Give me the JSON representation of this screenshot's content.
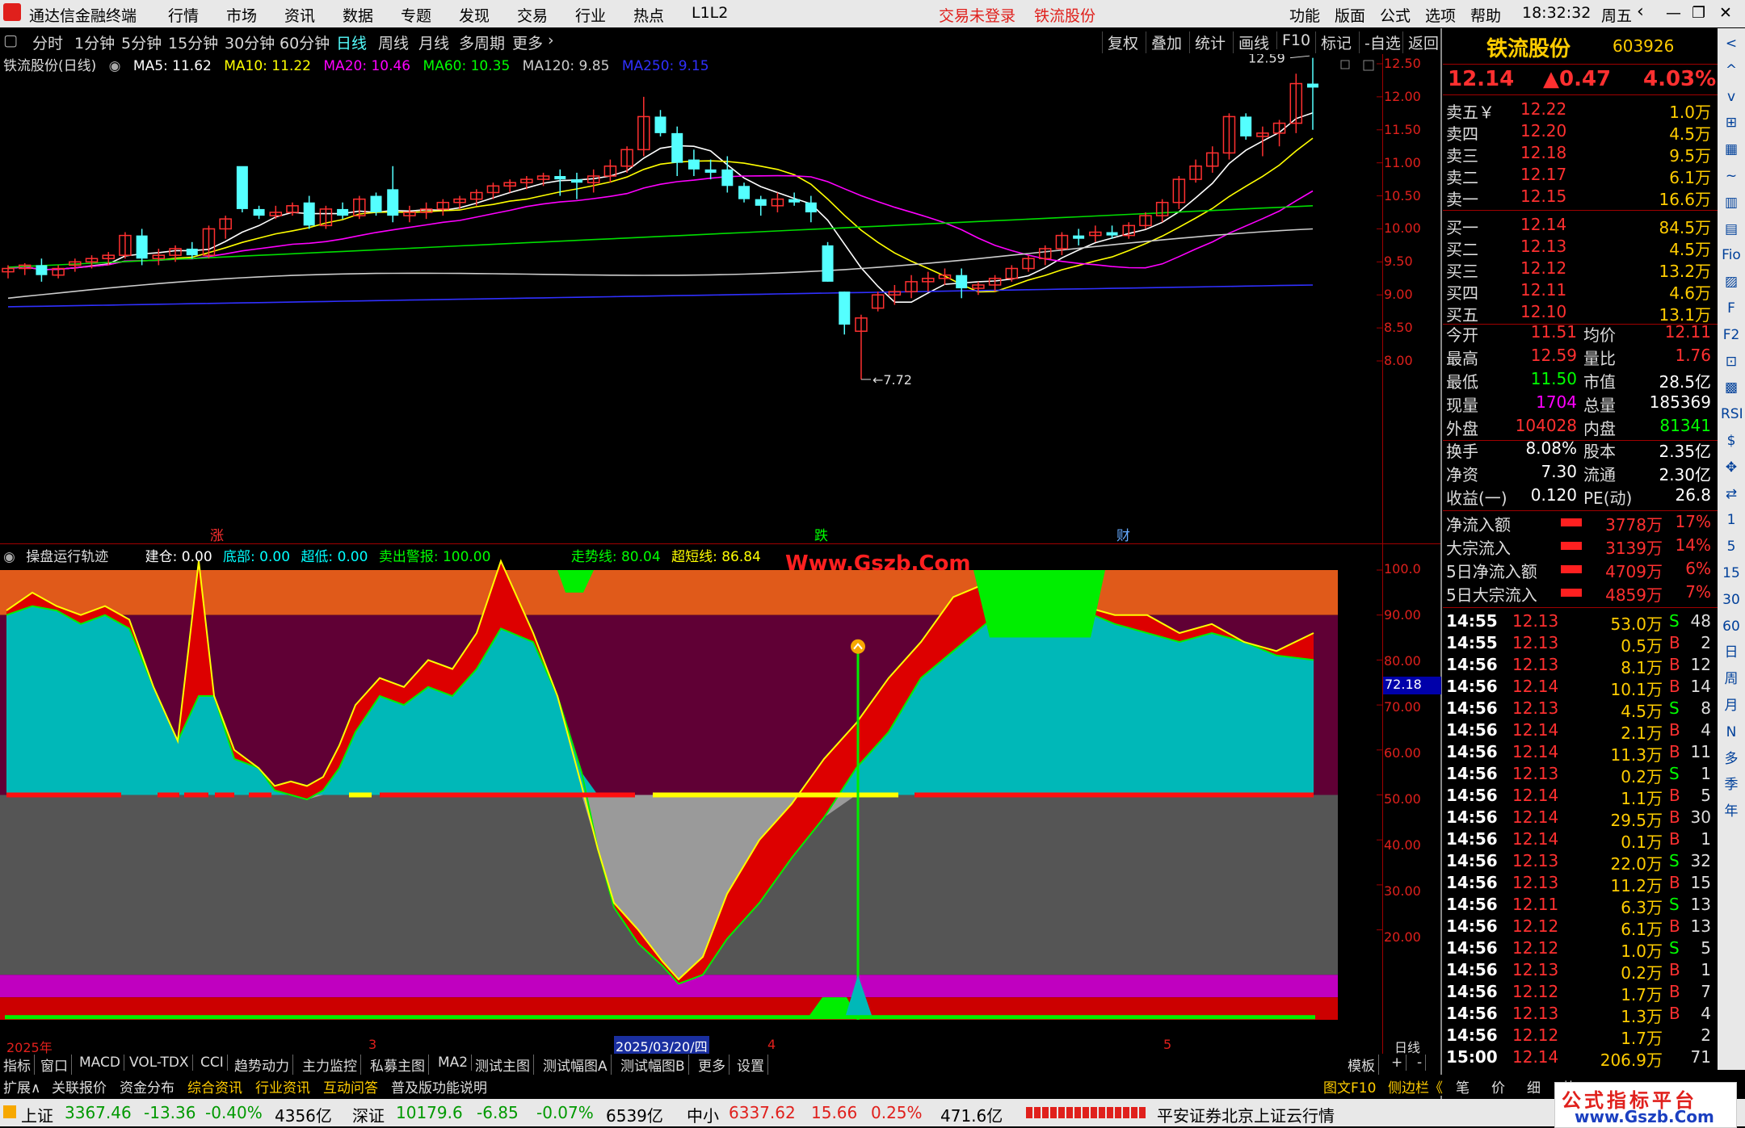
{
  "app": {
    "logo_text": "通达信金融终端",
    "menu": [
      "行情",
      "市场",
      "资讯",
      "数据",
      "专题",
      "发现",
      "交易",
      "行业",
      "热点",
      "L1L2"
    ],
    "trade_status": "交易未登录",
    "stock_short": "铁流股份",
    "right_menu": [
      "功能",
      "版面",
      "公式",
      "选项",
      "帮助"
    ],
    "time": "18:32:32",
    "weekday": "周五"
  },
  "timeframe": {
    "tabs": [
      "分时",
      "1分钟",
      "5分钟",
      "15分钟",
      "30分钟",
      "60分钟",
      "日线",
      "周线",
      "月线",
      "多周期",
      "更多"
    ],
    "active": "日线",
    "tools": [
      "复权",
      "叠加",
      "统计",
      "画线",
      "F10",
      "标记",
      "-自选",
      "返回"
    ]
  },
  "ma_header": {
    "title": "铁流股份(日线)",
    "items": [
      {
        "label": "MA5: 11.62",
        "color": "#ffffff"
      },
      {
        "label": "MA10: 11.22",
        "color": "#ffff00"
      },
      {
        "label": "MA20: 10.46",
        "color": "#ff00ff"
      },
      {
        "label": "MA60: 10.35",
        "color": "#00ff00"
      },
      {
        "label": "MA120: 9.85",
        "color": "#cccccc"
      },
      {
        "label": "MA250: 9.15",
        "color": "#3030ff"
      }
    ]
  },
  "price_axis": [
    "12.50",
    "12.00",
    "11.50",
    "11.00",
    "10.50",
    "10.00",
    "9.50",
    "9.00",
    "8.50",
    "8.00"
  ],
  "price_annotations": {
    "high": "12.59",
    "low": "7.72"
  },
  "markers": [
    {
      "text": "涨",
      "color": "#ff3030"
    },
    {
      "text": "跌",
      "color": "#00ff00"
    },
    {
      "text": "财",
      "color": "#66aaff"
    }
  ],
  "indicator_header": {
    "title": "操盘运行轨迹",
    "items": [
      {
        "label": "建仓: 0.00",
        "color": "#ffffff"
      },
      {
        "label": "底部: 0.00",
        "color": "#00ffff"
      },
      {
        "label": "超低: 0.00",
        "color": "#00ffff"
      },
      {
        "label": "卖出警报: 100.00",
        "color": "#00ff00"
      },
      {
        "label": "走势线: 80.04",
        "color": "#00ff00"
      },
      {
        "label": "超短线: 86.84",
        "color": "#ffff00"
      }
    ],
    "watermark": "Www.Gszb.Com"
  },
  "indicator_axis": [
    "100.0",
    "90.00",
    "80.00",
    "70.00",
    "60.00",
    "50.00",
    "40.00",
    "30.00",
    "20.00"
  ],
  "indicator_current": "72.18",
  "date_axis": {
    "labels": [
      "2025年",
      "3",
      "2025/03/20/四",
      "4",
      "5"
    ],
    "period": "日线"
  },
  "chart_data": {
    "type": "candlestick",
    "y_range": [
      7.72,
      12.59
    ],
    "candles": [
      [
        9.35,
        9.45,
        9.25,
        9.4
      ],
      [
        9.4,
        9.48,
        9.3,
        9.45
      ],
      [
        9.45,
        9.55,
        9.2,
        9.3
      ],
      [
        9.3,
        9.45,
        9.25,
        9.4
      ],
      [
        9.45,
        9.55,
        9.35,
        9.5
      ],
      [
        9.5,
        9.6,
        9.4,
        9.55
      ],
      [
        9.55,
        9.65,
        9.45,
        9.6
      ],
      [
        9.6,
        9.95,
        9.55,
        9.9
      ],
      [
        9.9,
        10.0,
        9.45,
        9.55
      ],
      [
        9.55,
        9.7,
        9.45,
        9.6
      ],
      [
        9.6,
        9.75,
        9.5,
        9.7
      ],
      [
        9.7,
        9.8,
        9.55,
        9.6
      ],
      [
        9.6,
        10.05,
        9.55,
        10.0
      ],
      [
        10.0,
        10.2,
        9.85,
        10.15
      ],
      [
        10.95,
        10.5,
        10.25,
        10.3
      ],
      [
        10.3,
        10.35,
        10.15,
        10.2
      ],
      [
        10.2,
        10.35,
        10.15,
        10.25
      ],
      [
        10.25,
        10.4,
        10.2,
        10.35
      ],
      [
        10.4,
        10.5,
        10.0,
        10.05
      ],
      [
        10.05,
        10.35,
        10.0,
        10.3
      ],
      [
        10.3,
        10.4,
        10.15,
        10.2
      ],
      [
        10.2,
        10.5,
        10.15,
        10.45
      ],
      [
        10.5,
        10.55,
        10.2,
        10.25
      ],
      [
        10.6,
        10.95,
        10.1,
        10.2
      ],
      [
        10.2,
        10.35,
        10.1,
        10.25
      ],
      [
        10.25,
        10.4,
        10.15,
        10.3
      ],
      [
        10.3,
        10.45,
        10.2,
        10.4
      ],
      [
        10.4,
        10.5,
        10.3,
        10.45
      ],
      [
        10.45,
        10.6,
        10.35,
        10.55
      ],
      [
        10.55,
        10.7,
        10.45,
        10.65
      ],
      [
        10.65,
        10.75,
        10.55,
        10.7
      ],
      [
        10.7,
        10.8,
        10.6,
        10.75
      ],
      [
        10.75,
        10.85,
        10.65,
        10.8
      ],
      [
        10.8,
        10.9,
        10.5,
        10.75
      ],
      [
        10.75,
        10.85,
        10.45,
        10.7
      ],
      [
        10.7,
        10.9,
        10.55,
        10.8
      ],
      [
        10.8,
        11.05,
        10.7,
        10.95
      ],
      [
        10.95,
        11.25,
        10.85,
        11.2
      ],
      [
        11.2,
        12.0,
        11.1,
        11.7
      ],
      [
        11.7,
        11.8,
        11.4,
        11.45
      ],
      [
        11.45,
        11.55,
        10.8,
        11.0
      ],
      [
        11.05,
        11.2,
        10.8,
        10.9
      ],
      [
        10.9,
        11.05,
        10.75,
        10.85
      ],
      [
        10.9,
        11.1,
        10.55,
        10.65
      ],
      [
        10.65,
        10.7,
        10.4,
        10.45
      ],
      [
        10.45,
        10.5,
        10.2,
        10.35
      ],
      [
        10.35,
        10.55,
        10.25,
        10.45
      ],
      [
        10.45,
        10.55,
        10.35,
        10.4
      ],
      [
        10.4,
        10.5,
        10.1,
        10.25
      ],
      [
        9.75,
        9.8,
        9.2,
        9.2
      ],
      [
        9.05,
        9.05,
        8.4,
        8.55
      ],
      [
        8.45,
        8.7,
        7.72,
        8.65
      ],
      [
        8.8,
        9.05,
        8.75,
        9.0
      ],
      [
        9.0,
        9.15,
        8.85,
        9.05
      ],
      [
        9.05,
        9.3,
        8.95,
        9.2
      ],
      [
        9.2,
        9.35,
        9.05,
        9.25
      ],
      [
        9.25,
        9.4,
        9.15,
        9.3
      ],
      [
        9.3,
        9.4,
        8.95,
        9.1
      ],
      [
        9.1,
        9.2,
        9.0,
        9.15
      ],
      [
        9.15,
        9.3,
        9.05,
        9.25
      ],
      [
        9.25,
        9.45,
        9.2,
        9.4
      ],
      [
        9.4,
        9.6,
        9.35,
        9.55
      ],
      [
        9.55,
        9.75,
        9.45,
        9.7
      ],
      [
        9.7,
        9.95,
        9.6,
        9.9
      ],
      [
        9.9,
        10.0,
        9.75,
        9.85
      ],
      [
        9.9,
        10.05,
        9.8,
        9.95
      ],
      [
        9.95,
        10.05,
        9.85,
        9.9
      ],
      [
        9.9,
        10.1,
        9.85,
        10.05
      ],
      [
        10.05,
        10.25,
        10.0,
        10.2
      ],
      [
        10.2,
        10.45,
        10.1,
        10.4
      ],
      [
        10.4,
        10.8,
        10.3,
        10.75
      ],
      [
        10.75,
        11.05,
        10.7,
        10.95
      ],
      [
        10.95,
        11.25,
        10.85,
        11.15
      ],
      [
        11.15,
        11.75,
        11.05,
        11.7
      ],
      [
        11.7,
        11.75,
        11.35,
        11.4
      ],
      [
        11.4,
        11.55,
        11.1,
        11.45
      ],
      [
        11.45,
        11.65,
        11.25,
        11.6
      ],
      [
        11.6,
        12.35,
        11.45,
        12.2
      ],
      [
        12.2,
        12.59,
        11.5,
        12.14
      ]
    ]
  },
  "quote": {
    "name": "铁流股份",
    "code": "603926",
    "price": "12.14",
    "change": "▲0.47",
    "pct": "4.03%",
    "asks": [
      {
        "label": "卖五￥",
        "price": "12.22",
        "vol": "1.0万"
      },
      {
        "label": "卖四",
        "price": "12.20",
        "vol": "4.5万"
      },
      {
        "label": "卖三",
        "price": "12.18",
        "vol": "9.5万"
      },
      {
        "label": "卖二",
        "price": "12.17",
        "vol": "6.1万"
      },
      {
        "label": "卖一",
        "price": "12.15",
        "vol": "16.6万"
      }
    ],
    "bids": [
      {
        "label": "买一",
        "price": "12.14",
        "vol": "84.5万"
      },
      {
        "label": "买二",
        "price": "12.13",
        "vol": "4.5万"
      },
      {
        "label": "买三",
        "price": "12.12",
        "vol": "13.2万"
      },
      {
        "label": "买四",
        "price": "12.11",
        "vol": "4.6万"
      },
      {
        "label": "买五",
        "price": "12.10",
        "vol": "13.1万"
      }
    ],
    "stats1": [
      {
        "l": "今开",
        "v": "11.51",
        "vc": "#ff3030",
        "l2": "均价",
        "v2": "12.11",
        "v2c": "#ff3030"
      },
      {
        "l": "最高",
        "v": "12.59",
        "vc": "#ff3030",
        "l2": "量比",
        "v2": "1.76",
        "v2c": "#ff3030"
      },
      {
        "l": "最低",
        "v": "11.50",
        "vc": "#00ff00",
        "l2": "市值",
        "v2": "28.5亿",
        "v2c": "#ffffff"
      },
      {
        "l": "现量",
        "v": "1704",
        "vc": "#ff00ff",
        "l2": "总量",
        "v2": "185369",
        "v2c": "#ffffff"
      },
      {
        "l": "外盘",
        "v": "104028",
        "vc": "#ff3030",
        "l2": "内盘",
        "v2": "81341",
        "v2c": "#00ff00"
      }
    ],
    "stats2": [
      {
        "l": "换手",
        "v": "8.08%",
        "l2": "股本",
        "v2": "2.35亿"
      },
      {
        "l": "净资",
        "v": "7.30",
        "l2": "流通",
        "v2": "2.30亿"
      },
      {
        "l": "收益(一)",
        "v": "0.120",
        "l2": "PE(动)",
        "v2": "26.8"
      }
    ],
    "flows": [
      {
        "l": "净流入额",
        "v": "3778万",
        "p": "17%"
      },
      {
        "l": "大宗流入",
        "v": "3139万",
        "p": "14%"
      },
      {
        "l": "5日净流入额",
        "v": "4709万",
        "p": "6%"
      },
      {
        "l": "5日大宗流入",
        "v": "4859万",
        "p": "7%"
      }
    ],
    "ticks": [
      {
        "t": "14:55",
        "p": "12.13",
        "v": "53.0万",
        "d": "S",
        "n": "48"
      },
      {
        "t": "14:55",
        "p": "12.13",
        "v": "0.5万",
        "d": "B",
        "n": "2"
      },
      {
        "t": "14:56",
        "p": "12.13",
        "v": "8.1万",
        "d": "B",
        "n": "12"
      },
      {
        "t": "14:56",
        "p": "12.14",
        "v": "10.1万",
        "d": "B",
        "n": "14"
      },
      {
        "t": "14:56",
        "p": "12.13",
        "v": "4.5万",
        "d": "S",
        "n": "8"
      },
      {
        "t": "14:56",
        "p": "12.14",
        "v": "2.1万",
        "d": "B",
        "n": "4"
      },
      {
        "t": "14:56",
        "p": "12.14",
        "v": "11.3万",
        "d": "B",
        "n": "11"
      },
      {
        "t": "14:56",
        "p": "12.13",
        "v": "0.2万",
        "d": "S",
        "n": "1"
      },
      {
        "t": "14:56",
        "p": "12.14",
        "v": "1.1万",
        "d": "B",
        "n": "5"
      },
      {
        "t": "14:56",
        "p": "12.14",
        "v": "29.5万",
        "d": "B",
        "n": "30"
      },
      {
        "t": "14:56",
        "p": "12.14",
        "v": "0.1万",
        "d": "B",
        "n": "1"
      },
      {
        "t": "14:56",
        "p": "12.13",
        "v": "22.0万",
        "d": "S",
        "n": "32"
      },
      {
        "t": "14:56",
        "p": "12.13",
        "v": "11.2万",
        "d": "B",
        "n": "15"
      },
      {
        "t": "14:56",
        "p": "12.11",
        "v": "6.3万",
        "d": "S",
        "n": "13"
      },
      {
        "t": "14:56",
        "p": "12.12",
        "v": "6.1万",
        "d": "B",
        "n": "13"
      },
      {
        "t": "14:56",
        "p": "12.12",
        "v": "1.0万",
        "d": "S",
        "n": "5"
      },
      {
        "t": "14:56",
        "p": "12.13",
        "v": "0.2万",
        "d": "B",
        "n": "1"
      },
      {
        "t": "14:56",
        "p": "12.12",
        "v": "1.7万",
        "d": "B",
        "n": "7"
      },
      {
        "t": "14:56",
        "p": "12.13",
        "v": "1.3万",
        "d": "B",
        "n": "4"
      },
      {
        "t": "14:56",
        "p": "12.12",
        "v": "1.7万",
        "d": "",
        "n": "2"
      },
      {
        "t": "15:00",
        "p": "12.14",
        "v": "206.9万",
        "d": "",
        "n": "71"
      }
    ]
  },
  "bottom_tabs": [
    "指标",
    "窗口",
    "MACD",
    "VOL-TDX",
    "CCI",
    "趋势动力",
    "主力监控",
    "私募主图",
    "MA2",
    "测试主图",
    "测试幅图A",
    "测试幅图B",
    "更多",
    "设置"
  ],
  "bottom_right": [
    "模板",
    "+",
    "-"
  ],
  "bottom_tabs2": [
    "扩展∧",
    "关联报价",
    "资金分布",
    "综合资讯",
    "行业资讯",
    "互动问答",
    "普及版功能说明"
  ],
  "bottom_tabs2_right": [
    "图文F10",
    "侧边栏《",
    "笔",
    "价",
    "细",
    "势"
  ],
  "status": {
    "sh_label": "上证",
    "sh_val": "3367.46",
    "sh_chg": "-13.36",
    "sh_pct": "-0.40%",
    "sh_amt": "4356亿",
    "sz_label": "深证",
    "sz_val": "10179.6",
    "sz_chg": "-6.85",
    "sz_pct": "-0.07%",
    "sz_amt": "6539亿",
    "zx_label": "中小",
    "zx_val": "6337.62",
    "zx_chg": "15.66",
    "zx_pct": "0.25%",
    "zx_amt": "471.6亿",
    "broker": "平安证券北京上证云行情",
    "wm_top": "公式指标平台",
    "wm_bot": "www.Gszb.Com"
  },
  "side_icons": [
    "<",
    "^",
    "v",
    "⊞",
    "▦",
    "~",
    "▥",
    "▤",
    "Fio",
    "▨",
    "F",
    "F2",
    "⊡",
    "▩",
    "RSI",
    "$",
    "✥",
    "⇄",
    "1",
    "5",
    "15",
    "30",
    "60",
    "日",
    "周",
    "月",
    "N",
    "多",
    "季",
    "年"
  ]
}
